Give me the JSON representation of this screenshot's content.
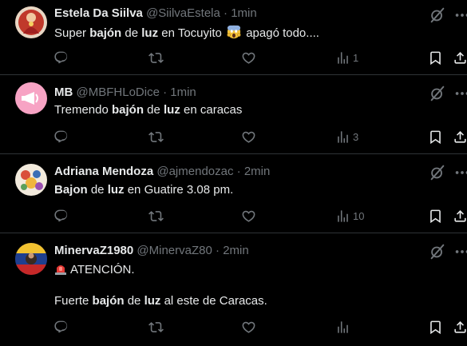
{
  "tweets": [
    {
      "name": "Estela Da Siilva",
      "handle": "@SiilvaEstela",
      "sep": "·",
      "time": "1min",
      "text_pre": "Super ",
      "text_b1": "bajón",
      "text_mid": " de ",
      "text_b2": "luz",
      "text_post": " en Tocuyito ",
      "text_end": " apagó todo....",
      "views": "1"
    },
    {
      "name": "MB",
      "handle": "@MBFHLoDice",
      "sep": "·",
      "time": "1min",
      "text_pre": "Tremendo ",
      "text_b1": "bajón",
      "text_mid": " de ",
      "text_b2": "luz",
      "text_post": " en caracas",
      "views": "3"
    },
    {
      "name": "Adriana Mendoza",
      "handle": "@ajmendozac",
      "sep": "·",
      "time": "2min",
      "text_b1": "Bajon",
      "text_mid": " de ",
      "text_b2": "luz",
      "text_post": " en Guatire 3.08 pm.",
      "views": "10"
    },
    {
      "name": "MinervaZ1980",
      "handle": "@MinervaZ80",
      "sep": "·",
      "time": "2min",
      "line1": "ATENCIÓN.",
      "text_pre": "Fuerte ",
      "text_b1": "bajón",
      "text_mid": " de ",
      "text_b2": "luz",
      "text_post": " al este de Caracas.",
      "views": ""
    }
  ],
  "colors": {
    "background": "#000000",
    "text": "#e7e9ea",
    "muted": "#71767b",
    "divider": "#2f3336"
  },
  "icons": [
    "reply-icon",
    "retweet-icon",
    "like-icon",
    "views-icon",
    "bookmark-icon",
    "share-icon",
    "grok-icon",
    "more-icon",
    "siren-emoji",
    "scream-emoji"
  ]
}
